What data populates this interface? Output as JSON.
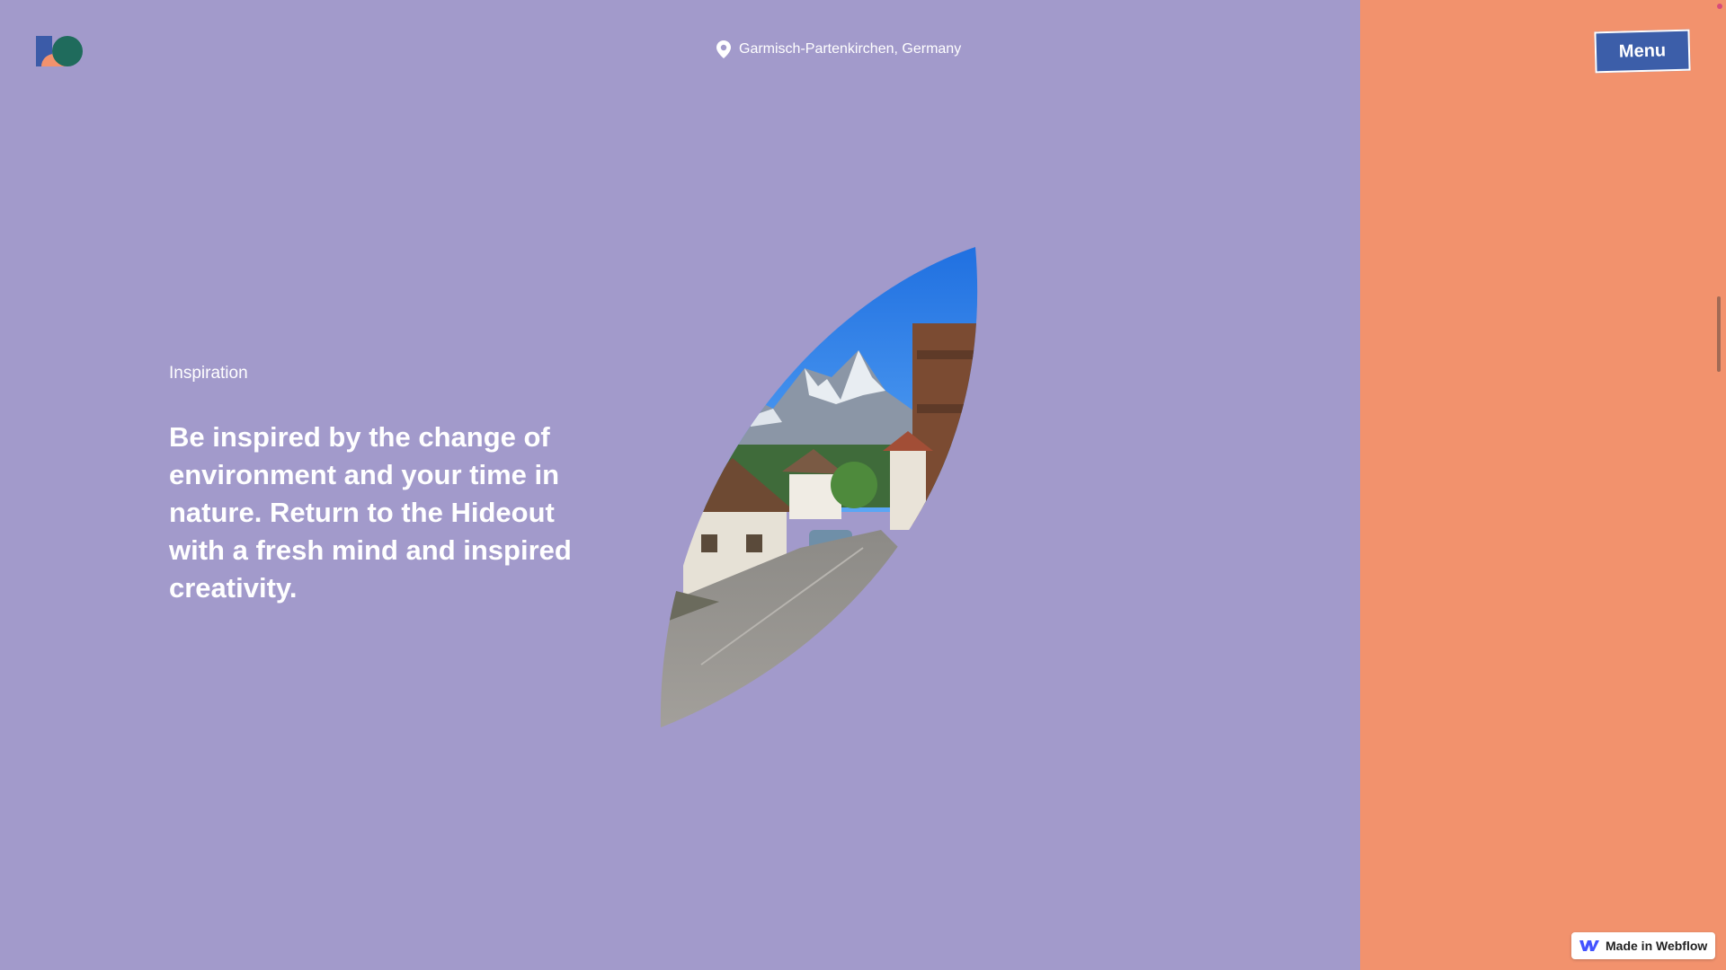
{
  "colors": {
    "left_bg": "#a29acb",
    "right_bg": "#f2926d",
    "menu_bg": "#3c5ea9",
    "logo_blue": "#3b5ba8",
    "logo_teal": "#1f6b5c",
    "logo_peach": "#f2926d",
    "webflow_blue": "#4353ff"
  },
  "header": {
    "logo_icon": "hideout-logo-icon",
    "location_icon": "map-pin-icon",
    "location_text": "Garmisch-Partenkirchen, Germany",
    "menu_label": "Menu"
  },
  "hero": {
    "eyebrow": "Inspiration",
    "headline": "Be inspired by the change of environment and your time in nature. Return to the Hideout with a fresh mind and inspired creativity.",
    "image_icon": "village-mountain-photo"
  },
  "badge": {
    "icon": "webflow-icon",
    "label": "Made in Webflow"
  }
}
